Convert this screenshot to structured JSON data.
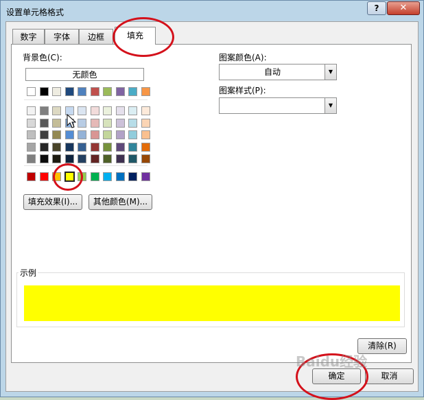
{
  "window": {
    "title": "设置单元格格式",
    "help_label": "?",
    "close_label": "✕"
  },
  "tabs": [
    {
      "label": "数字",
      "active": false
    },
    {
      "label": "字体",
      "active": false
    },
    {
      "label": "边框",
      "active": false
    },
    {
      "label": "填充",
      "active": true
    }
  ],
  "fill": {
    "background_label": "背景色(C):",
    "no_color_label": "无颜色",
    "theme_top_row": [
      "#ffffff",
      "#000000",
      "#eeece1",
      "#1f497d",
      "#4f81bd",
      "#c0504d",
      "#9bbb59",
      "#8064a2",
      "#4bacc6",
      "#f79646"
    ],
    "theme_shades": [
      [
        "#f2f2f2",
        "#7f7f7f",
        "#ddd9c3",
        "#c6d9f0",
        "#dbe5f1",
        "#f2dcdb",
        "#ebf1dd",
        "#e5e0ec",
        "#dbeef3",
        "#fdeada"
      ],
      [
        "#d8d8d8",
        "#595959",
        "#c4bd97",
        "#8db3e2",
        "#b8cce4",
        "#e5b9b7",
        "#d7e3bc",
        "#ccc1d9",
        "#b7dde8",
        "#fbd5b5"
      ],
      [
        "#bfbfbf",
        "#3f3f3f",
        "#938953",
        "#548dd4",
        "#95b3d7",
        "#d99694",
        "#c3d69b",
        "#b2a2c7",
        "#92cddc",
        "#fac08f"
      ],
      [
        "#a5a5a5",
        "#262626",
        "#494429",
        "#17365d",
        "#366092",
        "#953734",
        "#76923c",
        "#5f497a",
        "#31859b",
        "#e36c09"
      ],
      [
        "#7f7f7f",
        "#0c0c0c",
        "#1d1b10",
        "#0f243e",
        "#244061",
        "#632423",
        "#4f6128",
        "#3f3151",
        "#205867",
        "#974806"
      ]
    ],
    "standard_colors": [
      "#c00000",
      "#ff0000",
      "#ffc000",
      "#ffff00",
      "#92d050",
      "#00b050",
      "#00b0f0",
      "#0070c0",
      "#002060",
      "#7030a0"
    ],
    "selected_color": "#ffff00",
    "fill_effects_label": "填充效果(I)...",
    "more_colors_label": "其他颜色(M)...",
    "pattern_color_label": "图案颜色(A):",
    "pattern_color_value": "自动",
    "pattern_style_label": "图案样式(P):",
    "pattern_style_value": "",
    "sample_label": "示例",
    "clear_label": "清除(R)"
  },
  "footer": {
    "ok_label": "确定",
    "cancel_label": "取消"
  },
  "watermark_text": "Baidu经验"
}
